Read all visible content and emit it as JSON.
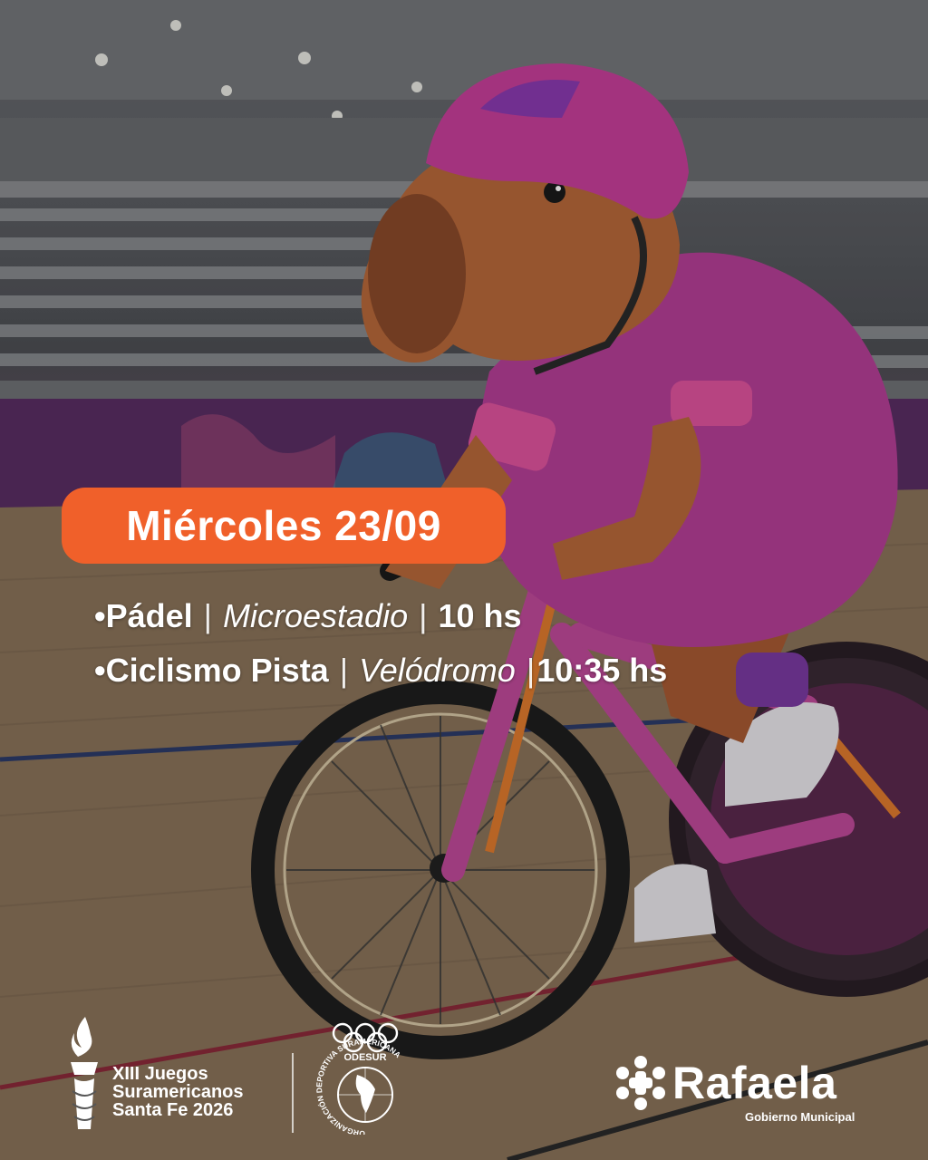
{
  "date_label": "Miércoles 23/09",
  "events": [
    {
      "sport": "Pádel",
      "venue": "Microestadio",
      "time": "10 hs"
    },
    {
      "sport": "Ciclismo Pista",
      "venue": "Velódromo",
      "time": "10:35 hs"
    }
  ],
  "bullet": "•",
  "separator": "|",
  "footer": {
    "games_line1": "XIII Juegos",
    "games_line2": "Suramericanos",
    "games_line3": "Santa Fe 2026",
    "odesur_label": "ODESUR",
    "odesur_ring": "ORGANIZACIÓN DEPORTIVA SURAMERICANA",
    "rafaela_name": "Rafaela",
    "rafaela_sub": "Gobierno Municipal"
  },
  "colors": {
    "accent": "#f0602a",
    "helmet": "#c73f9a",
    "suit": "#b53f96",
    "capybara": "#b8683a"
  },
  "illustration": "capybara-mascot-cycling-in-velodrome"
}
